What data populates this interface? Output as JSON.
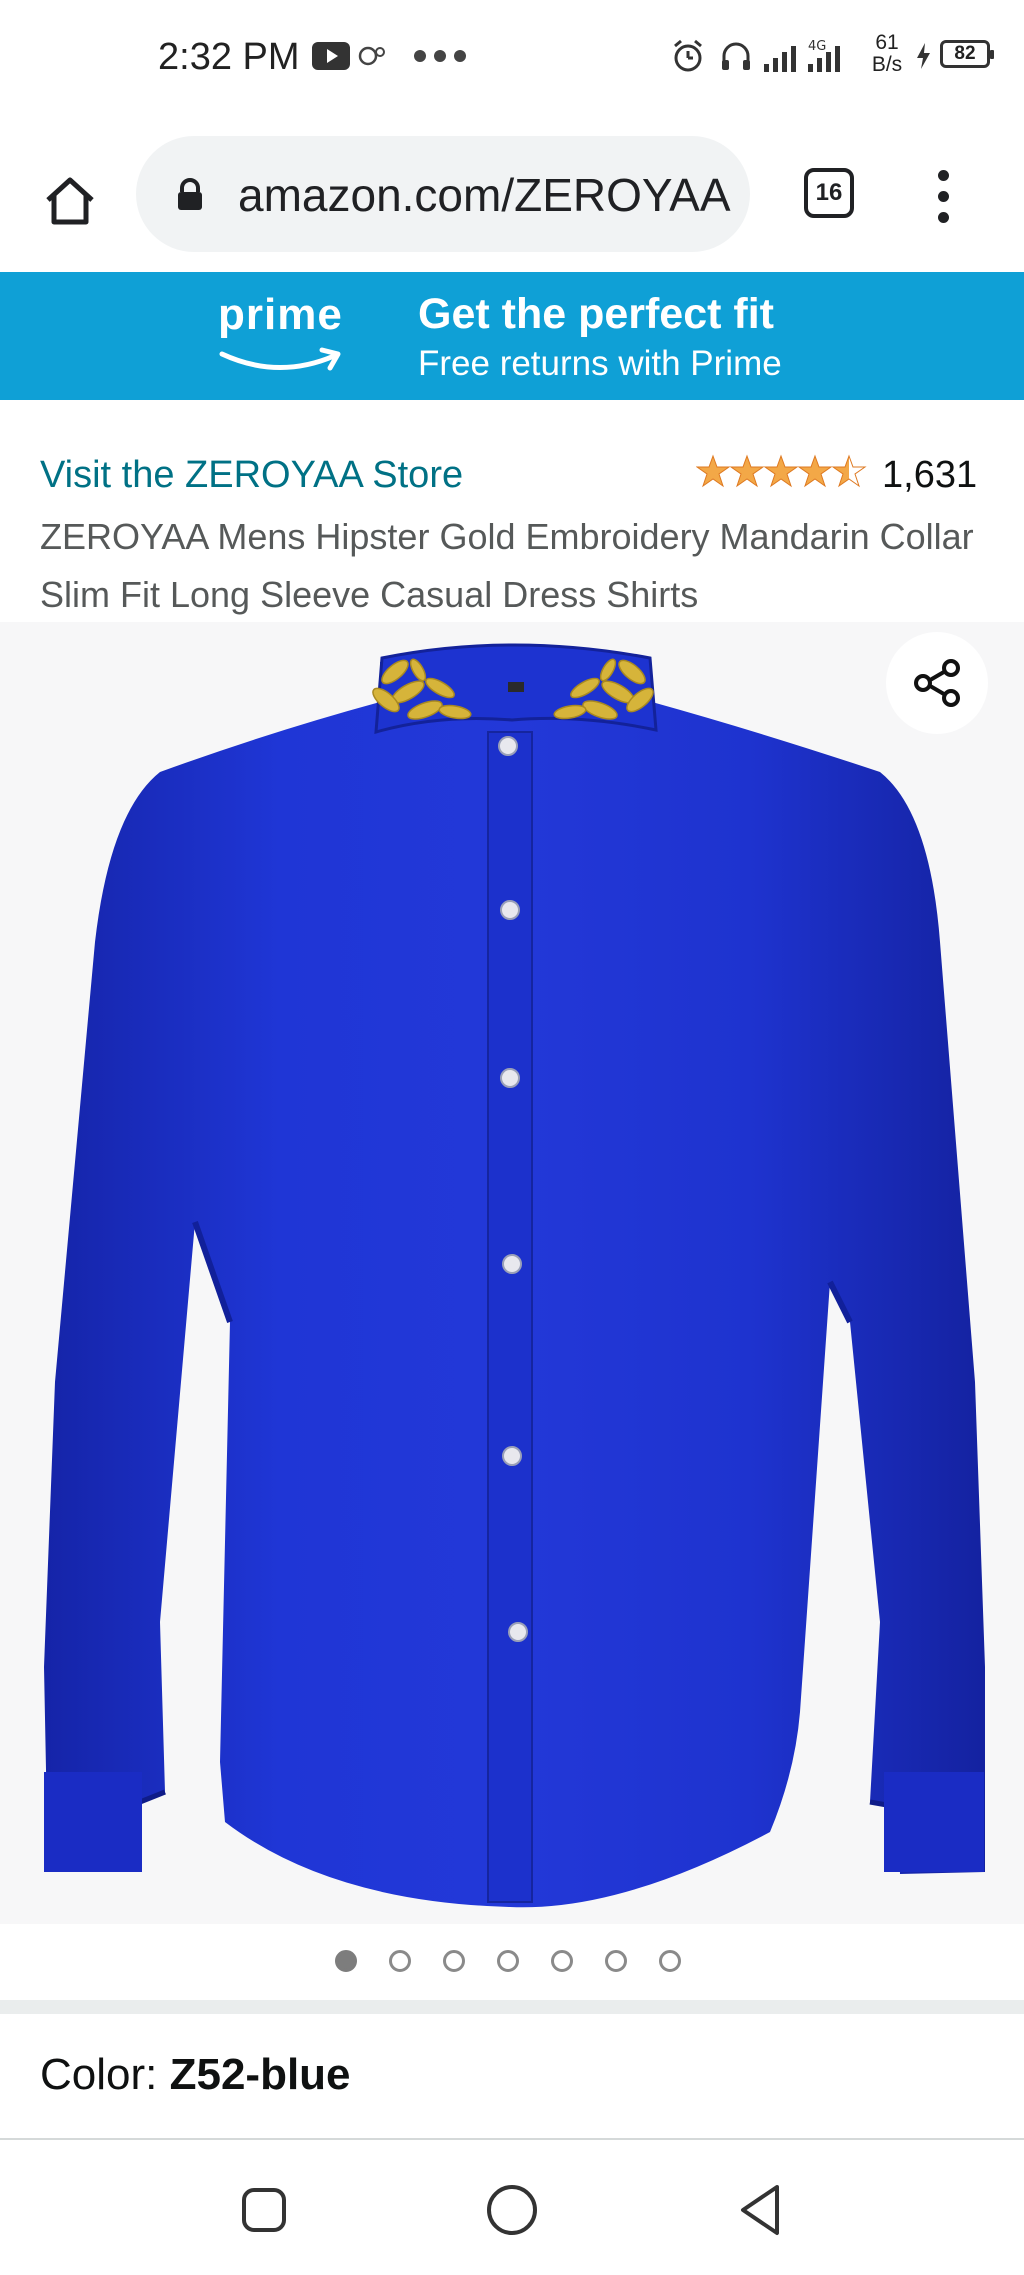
{
  "status": {
    "time": "2:32 PM",
    "net_speed_value": "61",
    "net_speed_unit": "B/s",
    "network_type": "4G",
    "battery": "82"
  },
  "browser": {
    "url": "amazon.com/ZEROYAA",
    "tab_count": "16"
  },
  "banner": {
    "logo_text": "prime",
    "headline": "Get the perfect fit",
    "subtext": "Free returns with Prime",
    "background": "#0fa0d6"
  },
  "product": {
    "store_link": "Visit the ZEROYAA Store",
    "rating_stars": 4.5,
    "rating_count": "1,631",
    "title": "ZEROYAA Mens Hipster Gold Embroidery Mandarin Collar Slim Fit Long Sleeve Casual Dress Shirts",
    "image_count": 7,
    "active_image": 1,
    "color_label": "Color:",
    "color_value": "Z52-blue",
    "shirt_color": "#1a2fd0",
    "embroidery_color": "#d6b43a"
  },
  "icons": {
    "home": "home-icon",
    "lock": "lock-icon",
    "menu": "more-vert-icon",
    "share": "share-icon",
    "nav_recent": "square-icon",
    "nav_home": "circle-icon",
    "nav_back": "triangle-back-icon"
  }
}
